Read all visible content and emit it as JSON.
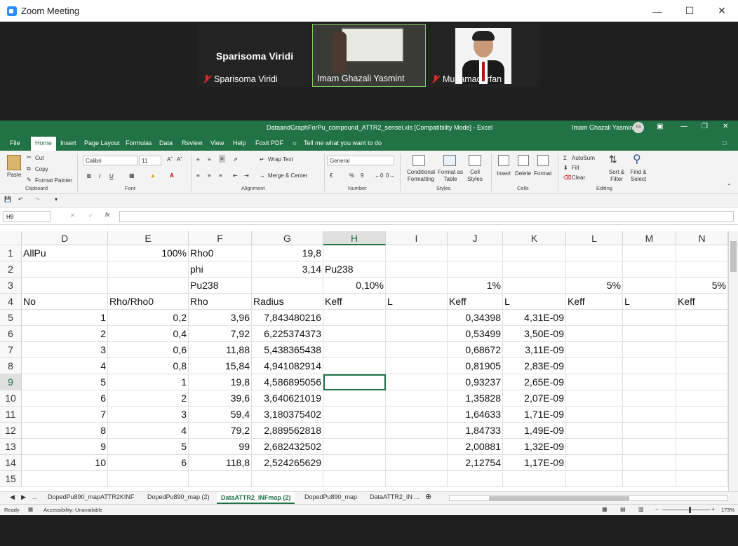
{
  "zoom": {
    "title": "Zoom Meeting",
    "participants": [
      {
        "big_name": "Sparisoma Viridi",
        "label": "Sparisoma Viridi",
        "muted": true
      },
      {
        "label": "Imam Ghazali Yasmint",
        "muted": false,
        "active": true
      },
      {
        "label": "Muhamad Irfan",
        "muted": true
      }
    ]
  },
  "excel": {
    "doc_title": "DataandGraphForPu_compound_ATTR2_sensei.xls  [Compatibility Mode]  -  Excel",
    "user": "Imam Ghazali Yasmint",
    "user_initials": "IG",
    "menu": [
      "File",
      "Home",
      "Insert",
      "Page Layout",
      "Formulas",
      "Data",
      "Review",
      "View",
      "Help",
      "Foxit PDF"
    ],
    "tell_me": "Tell me what you want to do",
    "ribbon": {
      "clipboard": {
        "paste": "Paste",
        "cut": "Cut",
        "copy": "Copy",
        "format_painter": "Format Painter",
        "label": "Clipboard"
      },
      "font": {
        "name": "Calibri",
        "size": "11",
        "label": "Font",
        "bold": "B",
        "italic": "I",
        "underline": "U"
      },
      "alignment": {
        "wrap": "Wrap Text",
        "merge": "Merge & Center",
        "label": "Alignment"
      },
      "number": {
        "format": "General",
        "label": "Number",
        "percent": "%",
        "comma": "9"
      },
      "styles": {
        "cond": "Conditional Formatting",
        "table": "Format as Table",
        "cell": "Cell Styles",
        "label": "Styles"
      },
      "cells": {
        "insert": "Insert",
        "delete": "Delete",
        "format": "Format",
        "label": "Cells"
      },
      "editing": {
        "autosum": "AutoSum",
        "fill": "Fill",
        "clear": "Clear",
        "sort": "Sort & Filter",
        "find": "Find & Select",
        "label": "Editing"
      }
    },
    "namebox": "H9",
    "columns": [
      "D",
      "E",
      "F",
      "G",
      "H",
      "I",
      "J",
      "K",
      "L",
      "M",
      "N"
    ],
    "selected_col": "H",
    "selected_row": "9",
    "rows": [
      {
        "n": "1",
        "D": "AllPu",
        "E": "100%",
        "F": "Rho0",
        "G": "19,8",
        "H": "",
        "I": "",
        "J": "",
        "K": "",
        "L": "",
        "M": "",
        "N": ""
      },
      {
        "n": "2",
        "D": "",
        "E": "",
        "F": "phi",
        "G": "3,14",
        "H": "Pu238",
        "I": "",
        "J": "",
        "K": "",
        "L": "",
        "M": "",
        "N": ""
      },
      {
        "n": "3",
        "D": "",
        "E": "",
        "F": "Pu238",
        "G": "",
        "H": "0,10%",
        "I": "",
        "J": "1%",
        "K": "",
        "L": "5%",
        "M": "",
        "N": "5%"
      },
      {
        "n": "4",
        "D": "No",
        "E": "Rho/Rho0",
        "F": "Rho",
        "G": "Radius",
        "H": "Keff",
        "I": "L",
        "J": "Keff",
        "K": "L",
        "L": "Keff",
        "M": "L",
        "N": "Keff"
      },
      {
        "n": "5",
        "D": "1",
        "E": "0,2",
        "F": "3,96",
        "G": "7,843480216",
        "H": "",
        "I": "",
        "J": "0,34398",
        "K": "4,31E-09",
        "L": "",
        "M": "",
        "N": ""
      },
      {
        "n": "6",
        "D": "2",
        "E": "0,4",
        "F": "7,92",
        "G": "6,225374373",
        "H": "",
        "I": "",
        "J": "0,53499",
        "K": "3,50E-09",
        "L": "",
        "M": "",
        "N": ""
      },
      {
        "n": "7",
        "D": "3",
        "E": "0,6",
        "F": "11,88",
        "G": "5,438365438",
        "H": "",
        "I": "",
        "J": "0,68672",
        "K": "3,11E-09",
        "L": "",
        "M": "",
        "N": ""
      },
      {
        "n": "8",
        "D": "4",
        "E": "0,8",
        "F": "15,84",
        "G": "4,941082914",
        "H": "",
        "I": "",
        "J": "0,81905",
        "K": "2,83E-09",
        "L": "",
        "M": "",
        "N": ""
      },
      {
        "n": "9",
        "D": "5",
        "E": "1",
        "F": "19,8",
        "G": "4,586895056",
        "H": "",
        "I": "",
        "J": "0,93237",
        "K": "2,65E-09",
        "L": "",
        "M": "",
        "N": ""
      },
      {
        "n": "10",
        "D": "6",
        "E": "2",
        "F": "39,6",
        "G": "3,640621019",
        "H": "",
        "I": "",
        "J": "1,35828",
        "K": "2,07E-09",
        "L": "",
        "M": "",
        "N": ""
      },
      {
        "n": "11",
        "D": "7",
        "E": "3",
        "F": "59,4",
        "G": "3,180375402",
        "H": "",
        "I": "",
        "J": "1,64633",
        "K": "1,71E-09",
        "L": "",
        "M": "",
        "N": ""
      },
      {
        "n": "12",
        "D": "8",
        "E": "4",
        "F": "79,2",
        "G": "2,889562818",
        "H": "",
        "I": "",
        "J": "1,84733",
        "K": "1,49E-09",
        "L": "",
        "M": "",
        "N": ""
      },
      {
        "n": "13",
        "D": "9",
        "E": "5",
        "F": "99",
        "G": "2,682432502",
        "H": "",
        "I": "",
        "J": "2,00881",
        "K": "1,32E-09",
        "L": "",
        "M": "",
        "N": ""
      },
      {
        "n": "14",
        "D": "10",
        "E": "6",
        "F": "118,8",
        "G": "2,524265629",
        "H": "",
        "I": "",
        "J": "2,12754",
        "K": "1,17E-09",
        "L": "",
        "M": "",
        "N": ""
      },
      {
        "n": "15",
        "D": "",
        "E": "",
        "F": "",
        "G": "",
        "H": "",
        "I": "",
        "J": "",
        "K": "",
        "L": "",
        "M": "",
        "N": ""
      }
    ],
    "sheets": [
      "...",
      "DopedPu890_mapATTR2KINF",
      "DopedPu890_map (2)",
      "DataATTR2_INFmap (2)",
      "DopedPu890_map",
      "DataATTR2_IN ..."
    ],
    "active_sheet": "DataATTR2_INFmap (2)",
    "status": {
      "ready": "Ready",
      "accessibility": "Accessibility: Unavailable",
      "zoom": "173%"
    },
    "colors": {
      "accent": "#217346"
    }
  }
}
